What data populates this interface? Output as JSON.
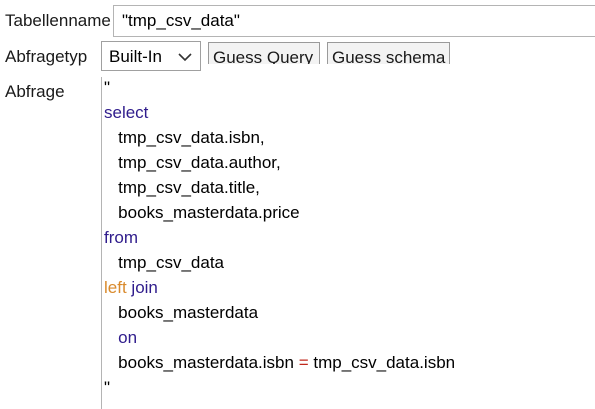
{
  "form": {
    "table_name_label": "Tabellenname",
    "table_name_value": "\"tmp_csv_data\"",
    "query_type_label": "Abfragetyp",
    "query_type_value": "Built-In",
    "guess_query_label": "Guess Query",
    "guess_schema_label": "Guess schema",
    "query_label": "Abfrage"
  },
  "query_lines": [
    {
      "indent": "",
      "parts": [
        {
          "t": "\"",
          "c": "plain"
        }
      ]
    },
    {
      "indent": "",
      "parts": [
        {
          "t": "select",
          "c": "kw"
        }
      ]
    },
    {
      "indent": "   ",
      "parts": [
        {
          "t": "tmp_csv_data.isbn,",
          "c": "plain"
        }
      ]
    },
    {
      "indent": "   ",
      "parts": [
        {
          "t": "tmp_csv_data.author,",
          "c": "plain"
        }
      ]
    },
    {
      "indent": "   ",
      "parts": [
        {
          "t": "tmp_csv_data.title,",
          "c": "plain"
        }
      ]
    },
    {
      "indent": "   ",
      "parts": [
        {
          "t": "books_masterdata.price",
          "c": "plain"
        }
      ]
    },
    {
      "indent": "",
      "parts": [
        {
          "t": "from",
          "c": "kw"
        }
      ]
    },
    {
      "indent": "   ",
      "parts": [
        {
          "t": "tmp_csv_data",
          "c": "plain"
        }
      ]
    },
    {
      "indent": "",
      "parts": [
        {
          "t": "left",
          "c": "kw-left"
        },
        {
          "t": " ",
          "c": "plain"
        },
        {
          "t": "join",
          "c": "kw"
        }
      ]
    },
    {
      "indent": "   ",
      "parts": [
        {
          "t": "books_masterdata",
          "c": "plain"
        }
      ]
    },
    {
      "indent": "   ",
      "parts": [
        {
          "t": "on",
          "c": "kw"
        }
      ]
    },
    {
      "indent": "   ",
      "parts": [
        {
          "t": "books_masterdata.isbn",
          "c": "plain"
        },
        {
          "t": " ",
          "c": "plain"
        },
        {
          "t": "=",
          "c": "op"
        },
        {
          "t": " ",
          "c": "plain"
        },
        {
          "t": "tmp_csv_data.isbn",
          "c": "plain"
        }
      ]
    },
    {
      "indent": "",
      "parts": [
        {
          "t": "\"",
          "c": "plain"
        }
      ]
    }
  ],
  "icons": {
    "select_arrow": "chevron-down-icon"
  },
  "colors": {
    "keyword": "#2f1c8c",
    "keyword_left": "#d98a2c",
    "operator": "#c0281c"
  }
}
